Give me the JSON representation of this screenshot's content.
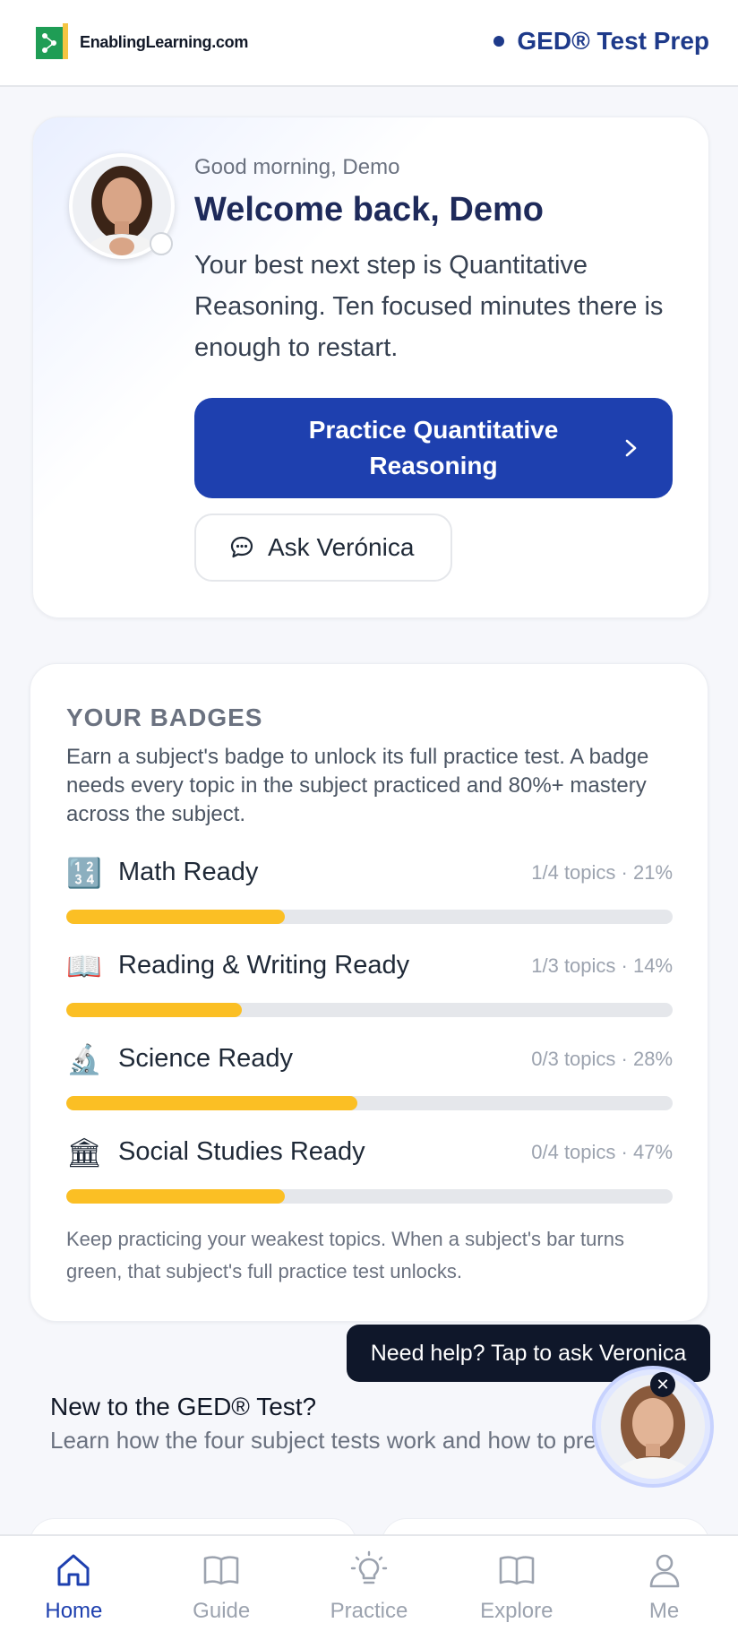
{
  "header": {
    "logo_text": "EnablingLearning.com",
    "title": "GED® Test Prep"
  },
  "welcome": {
    "greeting": "Good morning, Demo",
    "title": "Welcome back, Demo",
    "text": "Your best next step is Quantitative Reasoning. Ten focused minutes there is enough to restart.",
    "primary_button": "Practice Quantitative Reasoning",
    "secondary_button": "Ask Verónica"
  },
  "badges": {
    "title": "YOUR BADGES",
    "description": "Earn a subject's badge to unlock its full practice test. A badge needs every topic in the subject practiced and 80%+ mastery across the subject.",
    "items": [
      {
        "emoji": "🔢",
        "name": "Math Ready",
        "meta": "1/4 topics · 21%",
        "progress": 0.36
      },
      {
        "emoji": "📖",
        "name": "Reading & Writing Ready",
        "meta": "1/3 topics · 14%",
        "progress": 0.29
      },
      {
        "emoji": "🔬",
        "name": "Science Ready",
        "meta": "0/3 topics · 28%",
        "progress": 0.48
      },
      {
        "emoji": "🏛",
        "name": "Social Studies Ready",
        "meta": "0/4 topics · 47%",
        "progress": 0.36
      }
    ],
    "footer": "Keep practicing your weakest topics. When a subject's bar turns green, that subject's full practice test unlocks."
  },
  "intro": {
    "title": "New to the GED® Test?",
    "subtitle": "Learn how the four subject tests work and how to prepare."
  },
  "help": {
    "bubble": "Need help? Tap to ask Veronica"
  },
  "nav": {
    "items": [
      {
        "label": "Home",
        "icon": "home-icon",
        "active": true
      },
      {
        "label": "Guide",
        "icon": "book-icon",
        "active": false
      },
      {
        "label": "Practice",
        "icon": "lightbulb-icon",
        "active": false
      },
      {
        "label": "Explore",
        "icon": "book-open-icon",
        "active": false
      },
      {
        "label": "Me",
        "icon": "person-icon",
        "active": false
      }
    ]
  },
  "colors": {
    "primary": "#1e40af",
    "navy": "#1e2a5a",
    "progress": "#fbbf24"
  }
}
